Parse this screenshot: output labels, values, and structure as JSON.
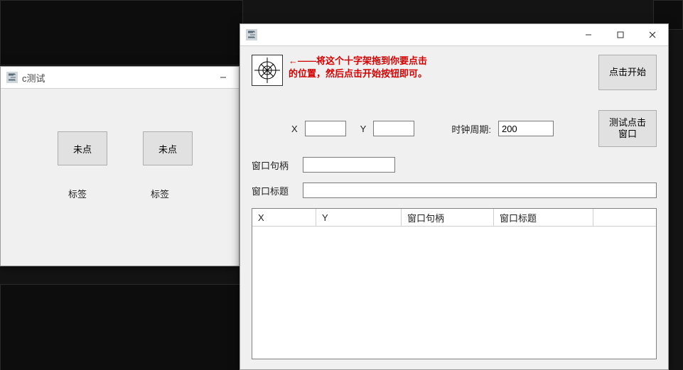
{
  "left_window": {
    "title": "c测试",
    "btn1": "未点",
    "btn2": "未点",
    "label1": "标签",
    "label2": "标签"
  },
  "main_window": {
    "title": "",
    "instruction_line1": "←——将这个十字架拖到你要点击",
    "instruction_line2": "的位置，然后点击开始按钮即可。",
    "start_btn": "点击开始",
    "x_label": "X",
    "y_label": "Y",
    "x_value": "",
    "y_value": "",
    "period_label": "时钟周期:",
    "period_value": "200",
    "test_btn_line1": "测试点击",
    "test_btn_line2": "窗口",
    "handle_label": "窗口句柄",
    "handle_value": "",
    "wtitle_label": "窗口标题",
    "wtitle_value": "",
    "cols": {
      "x": "X",
      "y": "Y",
      "handle": "窗口句柄",
      "title": "窗口标题"
    }
  },
  "icons": {
    "e_app": "易-app-icon",
    "crosshair": "crosshair-icon",
    "minimize": "minimize-icon",
    "maximize": "maximize-icon",
    "close": "close-icon"
  }
}
